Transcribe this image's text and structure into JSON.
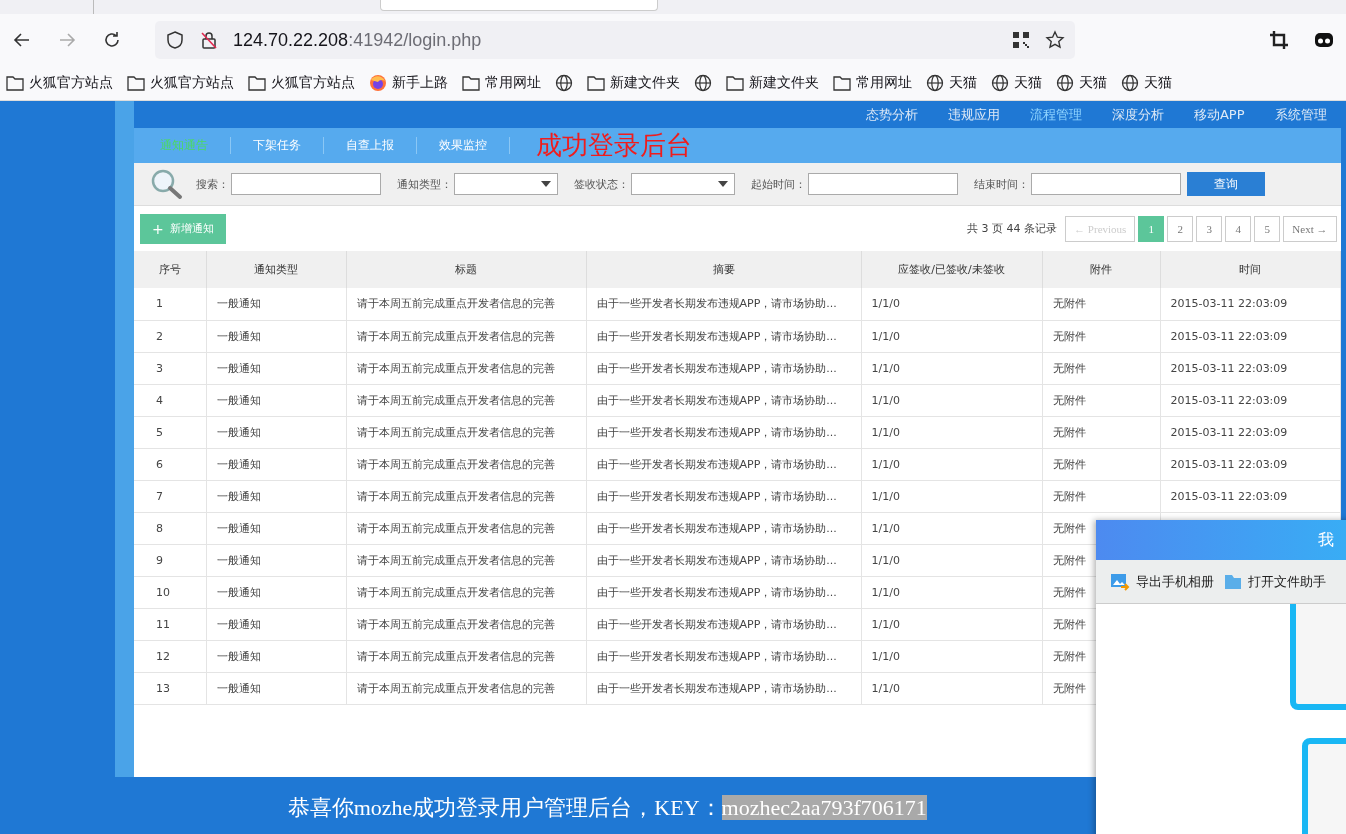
{
  "browser": {
    "url_host": "124.70.22.208",
    "url_path": ":41942/login.php",
    "bookmarks": [
      {
        "kind": "folder",
        "label": "火狐官方站点"
      },
      {
        "kind": "folder",
        "label": "火狐官方站点"
      },
      {
        "kind": "folder",
        "label": "火狐官方站点"
      },
      {
        "kind": "firefox",
        "label": "新手上路"
      },
      {
        "kind": "folder",
        "label": "常用网址"
      },
      {
        "kind": "globe"
      },
      {
        "kind": "folder",
        "label": "新建文件夹"
      },
      {
        "kind": "globe"
      },
      {
        "kind": "folder",
        "label": "新建文件夹"
      },
      {
        "kind": "folder",
        "label": "常用网址"
      },
      {
        "kind": "globe",
        "label": "天猫"
      },
      {
        "kind": "globe",
        "label": "天猫"
      },
      {
        "kind": "globe",
        "label": "天猫"
      },
      {
        "kind": "globe",
        "label": "天猫"
      }
    ]
  },
  "nav": [
    {
      "label": "态势分析",
      "selected": false
    },
    {
      "label": "违规应用",
      "selected": false
    },
    {
      "label": "流程管理",
      "selected": true
    },
    {
      "label": "深度分析",
      "selected": false
    },
    {
      "label": "移动APP",
      "selected": false
    },
    {
      "label": "系统管理",
      "selected": false
    }
  ],
  "subtabs": [
    {
      "label": "通知通告",
      "selected": true
    },
    {
      "label": "下架任务",
      "selected": false
    },
    {
      "label": "自查上报",
      "selected": false
    },
    {
      "label": "效果监控",
      "selected": false
    }
  ],
  "banner": "成功登录后台",
  "filters": [
    {
      "kind": "text",
      "label": "搜索："
    },
    {
      "kind": "select",
      "label": "通知类型："
    },
    {
      "kind": "select",
      "label": "签收状态："
    },
    {
      "kind": "text",
      "label": "起始时间："
    },
    {
      "kind": "text",
      "label": "结束时间："
    }
  ],
  "query_button": "查询",
  "add_button": "新增通知",
  "add_icon": "+",
  "record_summary": "共 3 页 44 条记录",
  "pagination": [
    {
      "label": "← Previous",
      "kind": "prev",
      "disabled": true,
      "selected": false
    },
    {
      "label": "1",
      "kind": "page",
      "disabled": false,
      "selected": true
    },
    {
      "label": "2",
      "kind": "page",
      "disabled": false,
      "selected": false
    },
    {
      "label": "3",
      "kind": "page",
      "disabled": false,
      "selected": false
    },
    {
      "label": "4",
      "kind": "page",
      "disabled": false,
      "selected": false
    },
    {
      "label": "5",
      "kind": "page",
      "disabled": false,
      "selected": false
    },
    {
      "label": "Next →",
      "kind": "next",
      "disabled": false,
      "selected": false
    }
  ],
  "table": {
    "columns": [
      "序号",
      "通知类型",
      "标题",
      "摘要",
      "应签收/已签收/未签收",
      "附件",
      "时间"
    ],
    "rows": [
      [
        "1",
        "一般通知",
        "请于本周五前完成重点开发者信息的完善",
        "由于一些开发者长期发布违规APP，请市场协助...",
        "1/1/0",
        "无附件",
        "2015-03-11 22:03:09"
      ],
      [
        "2",
        "一般通知",
        "请于本周五前完成重点开发者信息的完善",
        "由于一些开发者长期发布违规APP，请市场协助...",
        "1/1/0",
        "无附件",
        "2015-03-11 22:03:09"
      ],
      [
        "3",
        "一般通知",
        "请于本周五前完成重点开发者信息的完善",
        "由于一些开发者长期发布违规APP，请市场协助...",
        "1/1/0",
        "无附件",
        "2015-03-11 22:03:09"
      ],
      [
        "4",
        "一般通知",
        "请于本周五前完成重点开发者信息的完善",
        "由于一些开发者长期发布违规APP，请市场协助...",
        "1/1/0",
        "无附件",
        "2015-03-11 22:03:09"
      ],
      [
        "5",
        "一般通知",
        "请于本周五前完成重点开发者信息的完善",
        "由于一些开发者长期发布违规APP，请市场协助...",
        "1/1/0",
        "无附件",
        "2015-03-11 22:03:09"
      ],
      [
        "6",
        "一般通知",
        "请于本周五前完成重点开发者信息的完善",
        "由于一些开发者长期发布违规APP，请市场协助...",
        "1/1/0",
        "无附件",
        "2015-03-11 22:03:09"
      ],
      [
        "7",
        "一般通知",
        "请于本周五前完成重点开发者信息的完善",
        "由于一些开发者长期发布违规APP，请市场协助...",
        "1/1/0",
        "无附件",
        "2015-03-11 22:03:09"
      ],
      [
        "8",
        "一般通知",
        "请于本周五前完成重点开发者信息的完善",
        "由于一些开发者长期发布违规APP，请市场协助...",
        "1/1/0",
        "无附件"
      ],
      [
        "9",
        "一般通知",
        "请于本周五前完成重点开发者信息的完善",
        "由于一些开发者长期发布违规APP，请市场协助...",
        "1/1/0",
        "无附件"
      ],
      [
        "10",
        "一般通知",
        "请于本周五前完成重点开发者信息的完善",
        "由于一些开发者长期发布违规APP，请市场协助...",
        "1/1/0",
        "无附件"
      ],
      [
        "11",
        "一般通知",
        "请于本周五前完成重点开发者信息的完善",
        "由于一些开发者长期发布违规APP，请市场协助...",
        "1/1/0",
        "无附件"
      ],
      [
        "12",
        "一般通知",
        "请于本周五前完成重点开发者信息的完善",
        "由于一些开发者长期发布违规APP，请市场协助...",
        "1/1/0",
        "无附件"
      ],
      [
        "13",
        "一般通知",
        "请于本周五前完成重点开发者信息的完善",
        "由于一些开发者长期发布违规APP，请市场协助...",
        "1/1/0",
        "无附件"
      ]
    ]
  },
  "footer": {
    "message": "恭喜你mozhe成功登录用户管理后台，KEY：",
    "key": "mozhec2aa793f706171"
  },
  "popup": {
    "title": "我",
    "actions": [
      {
        "kind": "album",
        "label": "导出手机相册"
      },
      {
        "kind": "folder",
        "label": "打开文件助手"
      }
    ]
  }
}
